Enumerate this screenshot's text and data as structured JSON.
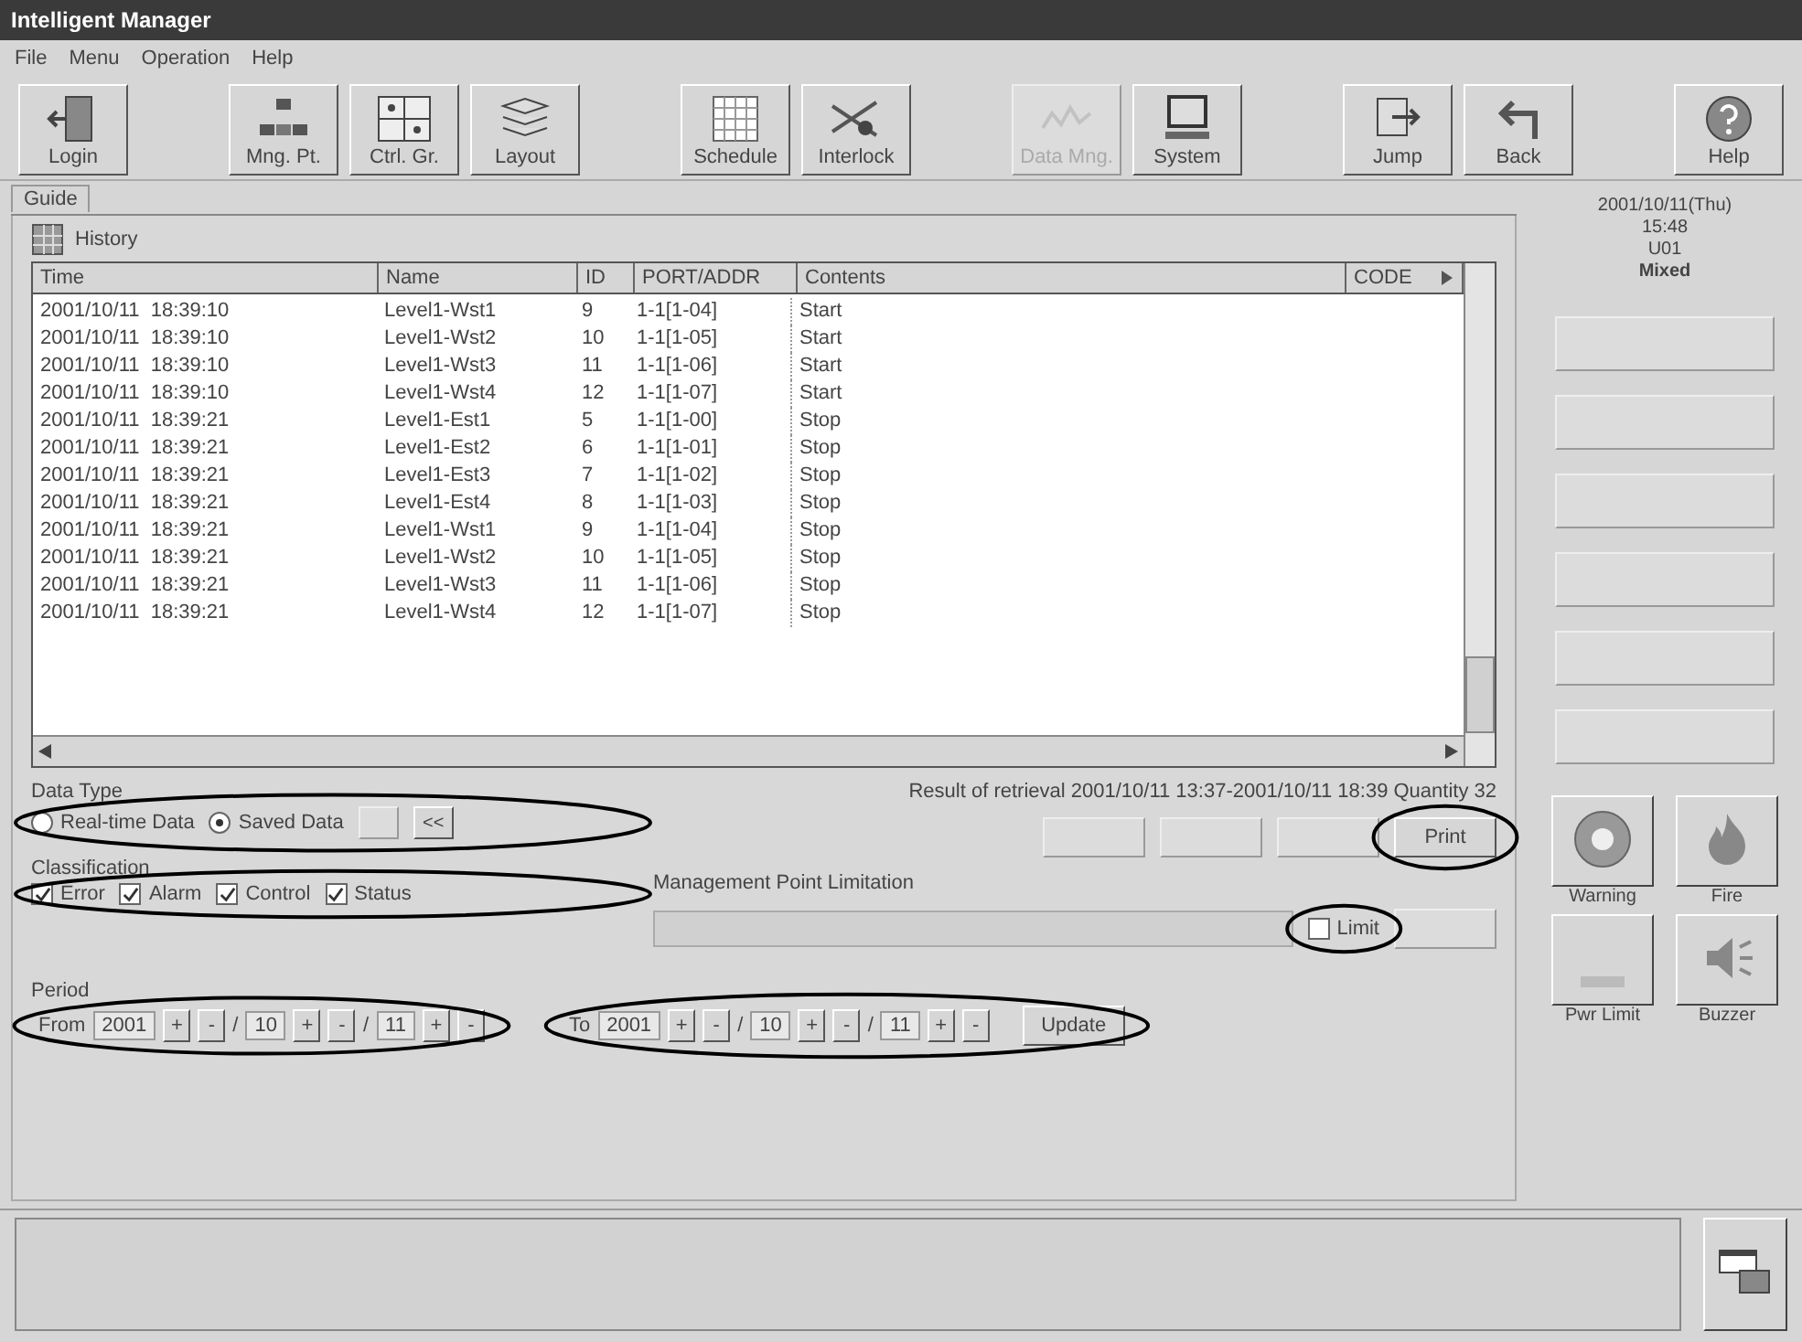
{
  "window": {
    "title": "Intelligent Manager"
  },
  "menu": [
    "File",
    "Menu",
    "Operation",
    "Help"
  ],
  "toolbar_groups": [
    {
      "buttons": [
        {
          "label": "Login",
          "disabled": false
        }
      ]
    },
    {
      "buttons": [
        {
          "label": "Mng. Pt.",
          "disabled": false
        },
        {
          "label": "Ctrl. Gr.",
          "disabled": false
        },
        {
          "label": "Layout",
          "disabled": false
        }
      ]
    },
    {
      "buttons": [
        {
          "label": "Schedule",
          "disabled": false
        },
        {
          "label": "Interlock",
          "disabled": false
        }
      ]
    },
    {
      "buttons": [
        {
          "label": "Data Mng.",
          "disabled": true
        },
        {
          "label": "System",
          "disabled": false
        }
      ]
    },
    {
      "buttons": [
        {
          "label": "Jump",
          "disabled": false
        },
        {
          "label": "Back",
          "disabled": false
        }
      ]
    },
    {
      "buttons": [
        {
          "label": "Help",
          "disabled": false
        }
      ]
    }
  ],
  "guide_tab": "Guide",
  "history": {
    "title": "History"
  },
  "table": {
    "columns": [
      "Time",
      "Name",
      "ID",
      "PORT/ADDR",
      "Contents",
      "CODE"
    ],
    "rows": [
      [
        "2001/10/11  18:39:10",
        "Level1-Wst1",
        "9",
        "1-1[1-04]",
        "Start"
      ],
      [
        "2001/10/11  18:39:10",
        "Level1-Wst2",
        "10",
        "1-1[1-05]",
        "Start"
      ],
      [
        "2001/10/11  18:39:10",
        "Level1-Wst3",
        "11",
        "1-1[1-06]",
        "Start"
      ],
      [
        "2001/10/11  18:39:10",
        "Level1-Wst4",
        "12",
        "1-1[1-07]",
        "Start"
      ],
      [
        "2001/10/11  18:39:21",
        "Level1-Est1",
        "5",
        "1-1[1-00]",
        "Stop"
      ],
      [
        "2001/10/11  18:39:21",
        "Level1-Est2",
        "6",
        "1-1[1-01]",
        "Stop"
      ],
      [
        "2001/10/11  18:39:21",
        "Level1-Est3",
        "7",
        "1-1[1-02]",
        "Stop"
      ],
      [
        "2001/10/11  18:39:21",
        "Level1-Est4",
        "8",
        "1-1[1-03]",
        "Stop"
      ],
      [
        "2001/10/11  18:39:21",
        "Level1-Wst1",
        "9",
        "1-1[1-04]",
        "Stop"
      ],
      [
        "2001/10/11  18:39:21",
        "Level1-Wst2",
        "10",
        "1-1[1-05]",
        "Stop"
      ],
      [
        "2001/10/11  18:39:21",
        "Level1-Wst3",
        "11",
        "1-1[1-06]",
        "Stop"
      ],
      [
        "2001/10/11  18:39:21",
        "Level1-Wst4",
        "12",
        "1-1[1-07]",
        "Stop"
      ]
    ]
  },
  "data_type": {
    "label": "Data Type",
    "circled": true,
    "options": [
      {
        "label": "Real-time Data",
        "selected": false
      },
      {
        "label": "Saved Data",
        "selected": true
      }
    ],
    "nav_buttons": [
      {
        "disabled": true
      },
      {
        "label": "<<",
        "disabled": false
      }
    ]
  },
  "classification": {
    "label": "Classification",
    "circled": true,
    "options": [
      {
        "label": "Error",
        "checked": true
      },
      {
        "label": "Alarm",
        "checked": true
      },
      {
        "label": "Control",
        "checked": true
      },
      {
        "label": "Status",
        "checked": true
      }
    ]
  },
  "result": "Result of retrieval 2001/10/11 13:37-2001/10/11 18:39  Quantity 32",
  "action_buttons": [
    {
      "disabled": true
    },
    {
      "disabled": true
    },
    {
      "disabled": true
    },
    {
      "label": "Print",
      "disabled": false,
      "circled": true
    }
  ],
  "limitation": {
    "label": "Management Point Limitation",
    "limit": {
      "label": "Limit",
      "checked": false,
      "circled": true
    }
  },
  "period": {
    "label": "Period",
    "from": {
      "label": "From",
      "year": "2001",
      "month": "10",
      "day": "11",
      "circled": true
    },
    "to": {
      "label": "To",
      "year": "2001",
      "month": "10",
      "day": "11",
      "circled": true
    },
    "update": "Update",
    "spin_plus": "+",
    "spin_minus": "-",
    "separator": "/"
  },
  "clock": {
    "date": "2001/10/11(Thu)",
    "time": "15:48",
    "user": "U01",
    "mode": "Mixed"
  },
  "side_buttons": [
    {
      "disabled": true
    },
    {
      "disabled": true
    },
    {
      "disabled": true
    },
    {
      "disabled": true
    },
    {
      "disabled": true
    },
    {
      "disabled": true
    }
  ],
  "alarm_buttons": [
    {
      "label": "Warning"
    },
    {
      "label": "Fire"
    },
    {
      "label": "Pwr Limit"
    },
    {
      "label": "Buzzer"
    }
  ]
}
